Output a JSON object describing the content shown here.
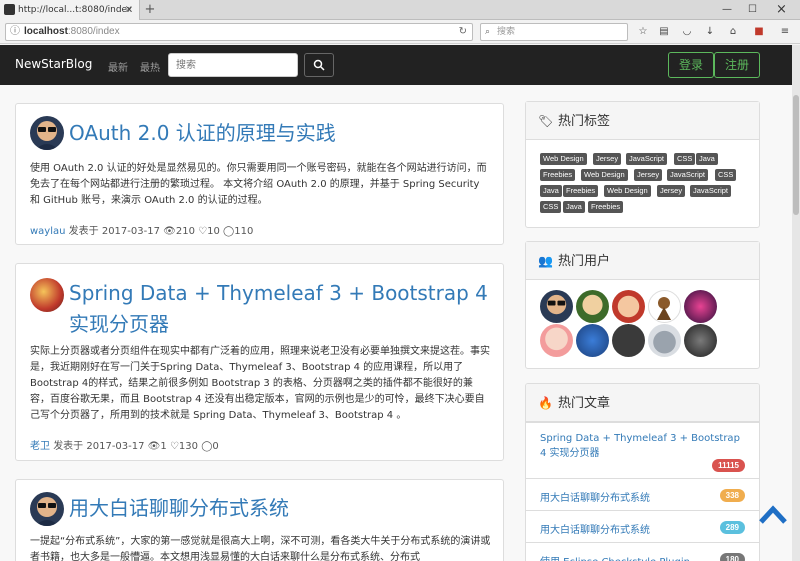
{
  "browser": {
    "tab_title": "http://local...t:8080/index",
    "tab_close": "×",
    "new_tab": "+",
    "url_host": "localhost",
    "url_rest": ":8080/index",
    "search_placeholder": "搜索",
    "min": "—",
    "max": "☐",
    "close": "×"
  },
  "site": {
    "brand": "NewStarBlog",
    "nav_newest": "最新",
    "nav_hottest": "最热",
    "search_placeholder": "搜索",
    "login": "登录",
    "register": "注册"
  },
  "posts": [
    {
      "title": "OAuth 2.0 认证的原理与实践",
      "excerpt": "使用 OAuth 2.0 认证的好处是显然易见的。你只需要用同一个账号密码，就能在各个网站进行访问，而免去了在每个网站都进行注册的繁琐过程。 本文将介绍 OAuth 2.0 的原理，并基于 Spring Security 和 GitHub 账号，来演示 OAuth 2.0 的认证的过程。",
      "author": "waylau",
      "posted": "发表于 2017-03-17",
      "views": "210",
      "likes": "10",
      "comments": "110"
    },
    {
      "title": "Spring Data + Thymeleaf 3 + Bootstrap 4 实现分页器",
      "excerpt": "实际上分页器或者分页组件在现实中都有广泛着的应用，照理来说老卫没有必要单独撰文来提这茬。事实是，我近期刚好在写一门关于Spring Data、Thymeleaf 3、Bootstrap 4 的应用课程，所以用了Bootstrap 4的样式，结果之前很多例如 Bootstrap 3 的表格、分页器啊之类的插件都不能很好的兼容，百度谷歌无果，而且 Bootstrap 4 还没有出稳定版本，官网的示例也是少的可怜，最终下决心要自己写个分页器了，所用到的技术就是 Spring Data、Thymeleaf 3、Bootstrap 4 。",
      "author": "老卫",
      "posted": "发表于 2017-03-17",
      "views": "1",
      "likes": "130",
      "comments": "0"
    },
    {
      "title": "用大白话聊聊分布式系统",
      "excerpt": "一提起“分布式系统”，大家的第一感觉就是很高大上啊，深不可测，看各类大牛关于分布式系统的演讲或者书籍，也大多是一般懵逼。本文想用浅显易懂的大白话来聊什么是分布式系统、分布式"
    }
  ],
  "sidebar": {
    "tags_title": "热门标签",
    "tags": [
      "Web Design",
      "Jersey",
      "JavaScript",
      "CSS",
      "Java",
      "Freebies",
      "Web Design",
      "Jersey",
      "JavaScript",
      "CSS",
      "Java",
      "Freebies",
      "Web Design",
      "Jersey",
      "JavaScript",
      "CSS",
      "Java",
      "Freebies"
    ],
    "users_title": "热门用户",
    "articles_title": "热门文章",
    "articles": [
      {
        "title": "Spring Data + Thymeleaf 3 + Bootstrap 4 实现分页器",
        "count": "11115",
        "color": "#d9534f"
      },
      {
        "title": "用大白话聊聊分布式系统",
        "count": "338",
        "color": "#f0ad4e"
      },
      {
        "title": "用大白话聊聊分布式系统",
        "count": "289",
        "color": "#5bc0de"
      },
      {
        "title": "使用 Eclipse Checkstyle Plugin",
        "count": "180",
        "color": "#777777"
      }
    ]
  },
  "colors": {
    "link": "#337ab7",
    "navbar": "#222222",
    "success": "#5cb85c"
  }
}
